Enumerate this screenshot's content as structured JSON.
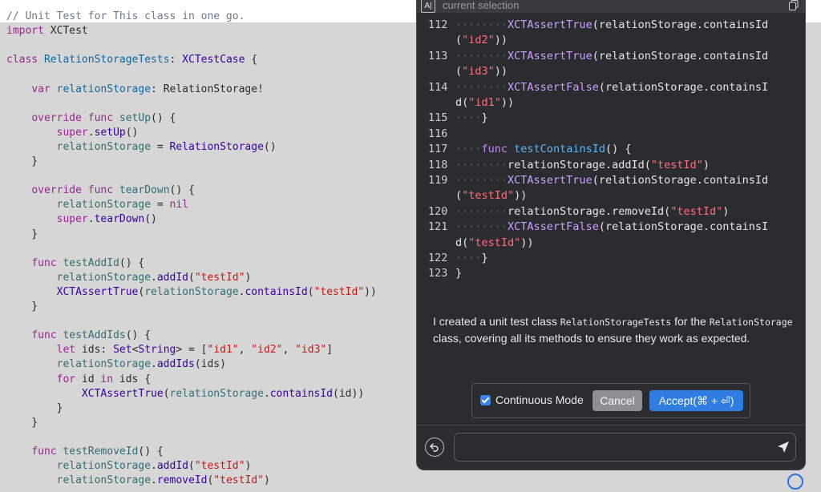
{
  "editor": {
    "lines": [
      [
        {
          "t": "// Unit Test for This class in one go.",
          "c": "cm"
        }
      ],
      [
        {
          "t": "import",
          "c": "kw"
        },
        {
          "t": " XCTest",
          "c": ""
        }
      ],
      [],
      [
        {
          "t": "class",
          "c": "kw"
        },
        {
          "t": " ",
          "c": ""
        },
        {
          "t": "RelationStorageTests",
          "c": "ty"
        },
        {
          "t": ": ",
          "c": ""
        },
        {
          "t": "XCTestCase",
          "c": "pl"
        },
        {
          "t": " {",
          "c": ""
        }
      ],
      [],
      [
        {
          "t": "    ",
          "c": ""
        },
        {
          "t": "var",
          "c": "kw"
        },
        {
          "t": " ",
          "c": ""
        },
        {
          "t": "relationStorage",
          "c": "ty"
        },
        {
          "t": ": ",
          "c": ""
        },
        {
          "t": "RelationStorage!",
          "c": ""
        }
      ],
      [],
      [
        {
          "t": "    ",
          "c": ""
        },
        {
          "t": "override",
          "c": "kw"
        },
        {
          "t": " ",
          "c": ""
        },
        {
          "t": "func",
          "c": "kw"
        },
        {
          "t": " ",
          "c": ""
        },
        {
          "t": "setUp",
          "c": "fn"
        },
        {
          "t": "() {",
          "c": ""
        }
      ],
      [
        {
          "t": "        ",
          "c": ""
        },
        {
          "t": "super",
          "c": "kw"
        },
        {
          "t": ".",
          "c": ""
        },
        {
          "t": "setUp",
          "c": "pl"
        },
        {
          "t": "()",
          "c": ""
        }
      ],
      [
        {
          "t": "        ",
          "c": ""
        },
        {
          "t": "relationStorage",
          "c": "fn"
        },
        {
          "t": " = ",
          "c": ""
        },
        {
          "t": "RelationStorage",
          "c": "pl"
        },
        {
          "t": "()",
          "c": ""
        }
      ],
      [
        {
          "t": "    }",
          "c": ""
        }
      ],
      [],
      [
        {
          "t": "    ",
          "c": ""
        },
        {
          "t": "override",
          "c": "kw"
        },
        {
          "t": " ",
          "c": ""
        },
        {
          "t": "func",
          "c": "kw"
        },
        {
          "t": " ",
          "c": ""
        },
        {
          "t": "tearDown",
          "c": "fn"
        },
        {
          "t": "() {",
          "c": ""
        }
      ],
      [
        {
          "t": "        ",
          "c": ""
        },
        {
          "t": "relationStorage",
          "c": "fn"
        },
        {
          "t": " = ",
          "c": ""
        },
        {
          "t": "nil",
          "c": "kw"
        }
      ],
      [
        {
          "t": "        ",
          "c": ""
        },
        {
          "t": "super",
          "c": "kw"
        },
        {
          "t": ".",
          "c": ""
        },
        {
          "t": "tearDown",
          "c": "pl"
        },
        {
          "t": "()",
          "c": ""
        }
      ],
      [
        {
          "t": "    }",
          "c": ""
        }
      ],
      [],
      [
        {
          "t": "    ",
          "c": ""
        },
        {
          "t": "func",
          "c": "kw"
        },
        {
          "t": " ",
          "c": ""
        },
        {
          "t": "testAddId",
          "c": "fn"
        },
        {
          "t": "() {",
          "c": ""
        }
      ],
      [
        {
          "t": "        ",
          "c": ""
        },
        {
          "t": "relationStorage",
          "c": "fn"
        },
        {
          "t": ".",
          "c": ""
        },
        {
          "t": "addId",
          "c": "pl"
        },
        {
          "t": "(",
          "c": ""
        },
        {
          "t": "\"testId\"",
          "c": "st"
        },
        {
          "t": ")",
          "c": ""
        }
      ],
      [
        {
          "t": "        ",
          "c": ""
        },
        {
          "t": "XCTAssertTrue",
          "c": "pl"
        },
        {
          "t": "(",
          "c": ""
        },
        {
          "t": "relationStorage",
          "c": "fn"
        },
        {
          "t": ".",
          "c": ""
        },
        {
          "t": "containsId",
          "c": "pl"
        },
        {
          "t": "(",
          "c": ""
        },
        {
          "t": "\"testId\"",
          "c": "st"
        },
        {
          "t": "))",
          "c": ""
        }
      ],
      [
        {
          "t": "    }",
          "c": ""
        }
      ],
      [],
      [
        {
          "t": "    ",
          "c": ""
        },
        {
          "t": "func",
          "c": "kw"
        },
        {
          "t": " ",
          "c": ""
        },
        {
          "t": "testAddIds",
          "c": "fn"
        },
        {
          "t": "() {",
          "c": ""
        }
      ],
      [
        {
          "t": "        ",
          "c": ""
        },
        {
          "t": "let",
          "c": "kw"
        },
        {
          "t": " ids: ",
          "c": ""
        },
        {
          "t": "Set",
          "c": "pl"
        },
        {
          "t": "<",
          "c": ""
        },
        {
          "t": "String",
          "c": "pl"
        },
        {
          "t": "> = [",
          "c": ""
        },
        {
          "t": "\"id1\"",
          "c": "st"
        },
        {
          "t": ", ",
          "c": ""
        },
        {
          "t": "\"id2\"",
          "c": "st"
        },
        {
          "t": ", ",
          "c": ""
        },
        {
          "t": "\"id3\"",
          "c": "st"
        },
        {
          "t": "]",
          "c": ""
        }
      ],
      [
        {
          "t": "        ",
          "c": ""
        },
        {
          "t": "relationStorage",
          "c": "fn"
        },
        {
          "t": ".",
          "c": ""
        },
        {
          "t": "addIds",
          "c": "pl"
        },
        {
          "t": "(ids)",
          "c": ""
        }
      ],
      [
        {
          "t": "        ",
          "c": ""
        },
        {
          "t": "for",
          "c": "kw"
        },
        {
          "t": " id ",
          "c": ""
        },
        {
          "t": "in",
          "c": "kw"
        },
        {
          "t": " ids {",
          "c": ""
        }
      ],
      [
        {
          "t": "            ",
          "c": ""
        },
        {
          "t": "XCTAssertTrue",
          "c": "pl"
        },
        {
          "t": "(",
          "c": ""
        },
        {
          "t": "relationStorage",
          "c": "fn"
        },
        {
          "t": ".",
          "c": ""
        },
        {
          "t": "containsId",
          "c": "pl"
        },
        {
          "t": "(id))",
          "c": ""
        }
      ],
      [
        {
          "t": "        }",
          "c": ""
        }
      ],
      [
        {
          "t": "    }",
          "c": ""
        }
      ],
      [],
      [
        {
          "t": "    ",
          "c": ""
        },
        {
          "t": "func",
          "c": "kw"
        },
        {
          "t": " ",
          "c": ""
        },
        {
          "t": "testRemoveId",
          "c": "fn"
        },
        {
          "t": "() {",
          "c": ""
        }
      ],
      [
        {
          "t": "        ",
          "c": ""
        },
        {
          "t": "relationStorage",
          "c": "fn"
        },
        {
          "t": ".",
          "c": ""
        },
        {
          "t": "addId",
          "c": "pl"
        },
        {
          "t": "(",
          "c": ""
        },
        {
          "t": "\"testId\"",
          "c": "st"
        },
        {
          "t": ")",
          "c": ""
        }
      ],
      [
        {
          "t": "        ",
          "c": ""
        },
        {
          "t": "relationStorage",
          "c": "fn"
        },
        {
          "t": ".",
          "c": ""
        },
        {
          "t": "removeId",
          "c": "pl"
        },
        {
          "t": "(",
          "c": ""
        },
        {
          "t": "\"testId\"",
          "c": "st"
        },
        {
          "t": ")",
          "c": ""
        }
      ]
    ]
  },
  "panel": {
    "selection_icon_text": "A|",
    "selection_label": "current selection",
    "copy_icon": "copy-icon",
    "code_lines": [
      {
        "ln": "112",
        "dots": "        ",
        "parts": [
          {
            "t": "XCTAssertTrue",
            "c": "p-fn"
          },
          {
            "t": "(relationStorage.containsId",
            "c": ""
          }
        ]
      },
      {
        "ln": "",
        "dots": "",
        "parts": [
          {
            "t": "(",
            "c": ""
          },
          {
            "t": "\"id2\"",
            "c": "p-st"
          },
          {
            "t": "))",
            "c": ""
          }
        ]
      },
      {
        "ln": "113",
        "dots": "        ",
        "parts": [
          {
            "t": "XCTAssertTrue",
            "c": "p-fn"
          },
          {
            "t": "(relationStorage.containsId",
            "c": ""
          }
        ]
      },
      {
        "ln": "",
        "dots": "",
        "parts": [
          {
            "t": "(",
            "c": ""
          },
          {
            "t": "\"id3\"",
            "c": "p-st"
          },
          {
            "t": "))",
            "c": ""
          }
        ]
      },
      {
        "ln": "114",
        "dots": "        ",
        "parts": [
          {
            "t": "XCTAssertFalse",
            "c": "p-fn"
          },
          {
            "t": "(relationStorage.containsI",
            "c": ""
          }
        ]
      },
      {
        "ln": "",
        "dots": "",
        "parts": [
          {
            "t": "d(",
            "c": ""
          },
          {
            "t": "\"id1\"",
            "c": "p-st"
          },
          {
            "t": "))",
            "c": ""
          }
        ]
      },
      {
        "ln": "115",
        "dots": "    ",
        "parts": [
          {
            "t": "}",
            "c": ""
          }
        ]
      },
      {
        "ln": "116",
        "dots": "",
        "parts": []
      },
      {
        "ln": "117",
        "dots": "    ",
        "parts": [
          {
            "t": "func",
            "c": "p-kw"
          },
          {
            "t": " ",
            "c": ""
          },
          {
            "t": "testContainsId",
            "c": "p-def"
          },
          {
            "t": "() {",
            "c": ""
          }
        ]
      },
      {
        "ln": "118",
        "dots": "        ",
        "parts": [
          {
            "t": "relationStorage.addId(",
            "c": ""
          },
          {
            "t": "\"testId\"",
            "c": "p-st"
          },
          {
            "t": ")",
            "c": ""
          }
        ]
      },
      {
        "ln": "119",
        "dots": "        ",
        "parts": [
          {
            "t": "XCTAssertTrue",
            "c": "p-fn"
          },
          {
            "t": "(relationStorage.containsId",
            "c": ""
          }
        ]
      },
      {
        "ln": "",
        "dots": "",
        "parts": [
          {
            "t": "(",
            "c": ""
          },
          {
            "t": "\"testId\"",
            "c": "p-st"
          },
          {
            "t": "))",
            "c": ""
          }
        ]
      },
      {
        "ln": "120",
        "dots": "        ",
        "parts": [
          {
            "t": "relationStorage.removeId(",
            "c": ""
          },
          {
            "t": "\"testId\"",
            "c": "p-st"
          },
          {
            "t": ")",
            "c": ""
          }
        ]
      },
      {
        "ln": "121",
        "dots": "        ",
        "parts": [
          {
            "t": "XCTAssertFalse",
            "c": "p-fn"
          },
          {
            "t": "(relationStorage.containsI",
            "c": ""
          }
        ]
      },
      {
        "ln": "",
        "dots": "",
        "parts": [
          {
            "t": "d(",
            "c": ""
          },
          {
            "t": "\"testId\"",
            "c": "p-st"
          },
          {
            "t": "))",
            "c": ""
          }
        ]
      },
      {
        "ln": "122",
        "dots": "    ",
        "parts": [
          {
            "t": "}",
            "c": ""
          }
        ]
      },
      {
        "ln": "123",
        "dots": "",
        "parts": [
          {
            "t": "}",
            "c": ""
          }
        ]
      }
    ],
    "explanation": {
      "p1": "I created a unit test class ",
      "code1": "RelationStorageTests",
      "p2": " for the ",
      "code2": "RelationStorage",
      "p3": " class, covering all its methods to ensure they work as expected."
    },
    "continuous_mode_label": "Continuous Mode",
    "continuous_mode_checked": true,
    "cancel_label": "Cancel",
    "accept_label": "Accept(⌘ + ⏎)",
    "chat_input_value": "",
    "back_icon": "undo-icon",
    "send_icon": "send-icon"
  },
  "colors": {
    "panel_bg": "#2b2c30",
    "accent": "#2f7de1",
    "editor_bg": "#d6d6d6"
  }
}
